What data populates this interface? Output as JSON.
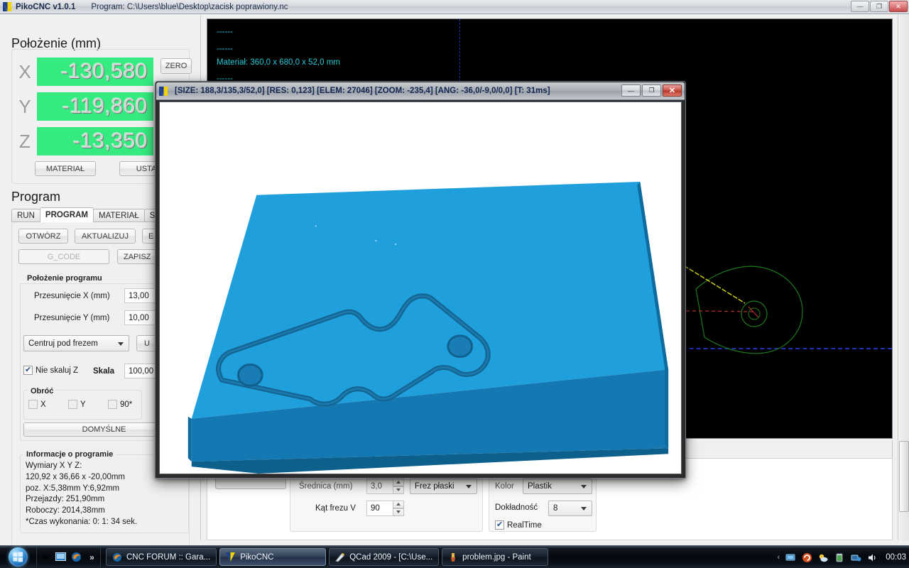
{
  "app": {
    "title": "PikoCNC v1.0.1",
    "program_path": "Program: C:\\Users\\blue\\Desktop\\zacisk poprawiony.nc",
    "window_buttons": {
      "minimize": "—",
      "maximize": "❐",
      "close": "✕"
    },
    "logo_name": "pikocnc-logo"
  },
  "position_panel": {
    "title": "Położenie (mm)",
    "axes": [
      {
        "name": "X",
        "value": "-130,580"
      },
      {
        "name": "Y",
        "value": "-119,860"
      },
      {
        "name": "Z",
        "value": "-13,350"
      }
    ],
    "zero_button": "ZERO",
    "material_button": "MATERIAŁ",
    "set_button": "USTAW"
  },
  "program_panel": {
    "title": "Program",
    "tabs": [
      {
        "label": "RUN",
        "active": false
      },
      {
        "label": "PROGRAM",
        "active": true
      },
      {
        "label": "MATERIAŁ",
        "active": false
      },
      {
        "label": "S",
        "active": false
      }
    ],
    "buttons": {
      "open": "OTWÓRZ",
      "update": "AKTUALIZUJ",
      "third": "E",
      "gcode": "G_CODE",
      "save": "ZAPISZ"
    },
    "program_position": {
      "group_title": "Położenie programu",
      "offset_x_label": "Przesunięcie X (mm)",
      "offset_x_value": "13,00",
      "offset_y_label": "Przesunięcie Y (mm)",
      "offset_y_value": "10,00",
      "center_mode": "Centruj pod frezem",
      "set_button": "U",
      "no_scale_z_label": "Nie skaluj Z",
      "no_scale_z_checked": true,
      "scale_label": "Skala",
      "scale_value": "100,00",
      "rotate_group": "Obróć",
      "rotate_x": "X",
      "rotate_y": "Y",
      "rotate_90": "90*",
      "defaults_button": "DOMYŚLNE"
    },
    "info": {
      "group_title": "Informacje o programie",
      "lines": [
        "Wymiary X Y Z:",
        "120,92 x 36,66 x -20,00mm",
        "poz. X:5,38mm Y:6,92mm",
        "Przejazdy: 251,90mm",
        "Roboczy: 2014,38mm",
        "*Czas wykonania: 0: 1: 34 sek."
      ]
    }
  },
  "console": {
    "lines": [
      "------",
      "------",
      "Materiał: 360,0 x 680,0 x 52,0 mm",
      "------"
    ],
    "text_color": "#24c8d4",
    "background": "#000000",
    "grid_color": "#1f2fb0"
  },
  "tool_panel": {
    "diameter_label": "Średnica (mm)",
    "diameter_value": "3,0",
    "tool_type": "Frez płaski",
    "v_angle_label": "Kąt frezu V",
    "v_angle_value": "90",
    "color_label": "Kolor",
    "color_value": "Plastik",
    "accuracy_label": "Dokładność",
    "accuracy_value": "8",
    "realtime_label": "RealTime",
    "realtime_checked": true
  },
  "viewer": {
    "title": "[SIZE: 188,3/135,3/52,0] [RES: 0,123] [ELEM: 27046] [ZOOM: -235,4] [ANG: -36,0/-9,0/0,0] [T: 31ms]",
    "stats": {
      "size": "188,3/135,3/52,0",
      "res": "0,123",
      "elem": "27046",
      "zoom": "-235,4",
      "ang": "-36,0/-9,0/0,0",
      "t": "31ms"
    },
    "buttons": {
      "minimize": "—",
      "maximize": "❐",
      "close": "✕"
    },
    "block_color_top": "#1f9fdc",
    "block_color_front": "#1686c4",
    "block_color_side": "#0f6b9e",
    "groove_color": "#14638f"
  },
  "taskbar": {
    "start_label": "start-orb",
    "quick_icons": [
      "sun-icon",
      "show-desktop-icon",
      "firefox-icon",
      "chevron-right-icon"
    ],
    "items": [
      {
        "label": "CNC FORUM :: Gara...",
        "icon": "firefox-icon",
        "active": false
      },
      {
        "label": "PikoCNC",
        "icon": "pikocnc-icon",
        "active": true
      },
      {
        "label": "QCad 2009 - [C:\\Use...",
        "icon": "qcad-icon",
        "active": false
      },
      {
        "label": "problem.jpg - Paint",
        "icon": "paint-icon",
        "active": false
      }
    ],
    "tray_icons": [
      "chevron-left-icon",
      "network-monitor-icon",
      "shield-icon",
      "weather-icon",
      "battery-icon",
      "network-icon",
      "volume-icon"
    ],
    "clock": "00:03"
  }
}
